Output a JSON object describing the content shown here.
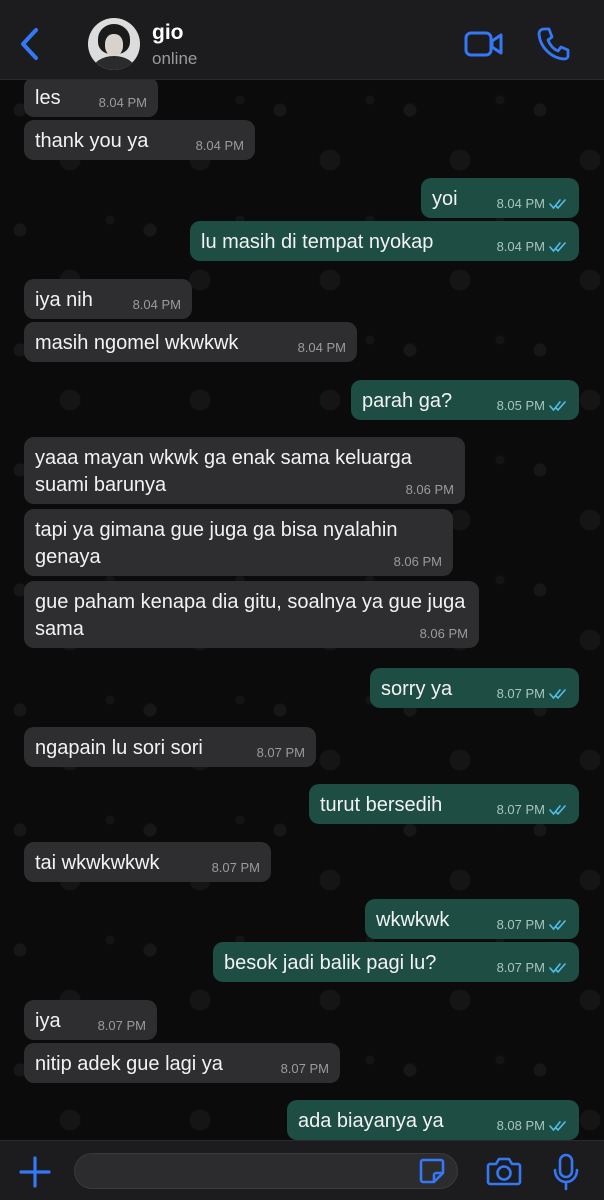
{
  "header": {
    "contact_name": "gio",
    "status": "online",
    "back_icon": "chevron-left-icon",
    "video_icon": "video-camera-icon",
    "call_icon": "phone-icon",
    "accent_color": "#3478f6"
  },
  "messages": [
    {
      "direction": "in",
      "text": "les",
      "time": "8.04 PM"
    },
    {
      "direction": "in",
      "text": "thank you ya",
      "time": "8.04 PM"
    },
    {
      "direction": "out",
      "text": "yoi",
      "time": "8.04 PM",
      "read": true
    },
    {
      "direction": "out",
      "text": "lu masih di tempat nyokap",
      "time": "8.04 PM",
      "read": true
    },
    {
      "direction": "in",
      "text": "iya nih",
      "time": "8.04 PM"
    },
    {
      "direction": "in",
      "text": "masih ngomel wkwkwk",
      "time": "8.04 PM"
    },
    {
      "direction": "out",
      "text": "parah ga?",
      "time": "8.05 PM",
      "read": true
    },
    {
      "direction": "in",
      "text": "yaaa mayan wkwk ga enak sama keluarga suami barunya",
      "time": "8.06 PM"
    },
    {
      "direction": "in",
      "text": "tapi ya gimana gue juga ga bisa nyalahin genaya",
      "time": "8.06 PM"
    },
    {
      "direction": "in",
      "text": "gue paham kenapa dia gitu, soalnya ya gue juga sama",
      "time": "8.06 PM"
    },
    {
      "direction": "out",
      "text": "sorry ya",
      "time": "8.07 PM",
      "read": true
    },
    {
      "direction": "in",
      "text": "ngapain lu sori sori",
      "time": "8.07 PM"
    },
    {
      "direction": "out",
      "text": "turut bersedih",
      "time": "8.07 PM",
      "read": true
    },
    {
      "direction": "in",
      "text": "tai wkwkwkwk",
      "time": "8.07 PM"
    },
    {
      "direction": "out",
      "text": "wkwkwk",
      "time": "8.07 PM",
      "read": true
    },
    {
      "direction": "out",
      "text": "besok jadi balik pagi lu?",
      "time": "8.07 PM",
      "read": true
    },
    {
      "direction": "in",
      "text": "iya",
      "time": "8.07 PM"
    },
    {
      "direction": "in",
      "text": "nitip adek gue lagi ya",
      "time": "8.07 PM"
    },
    {
      "direction": "out",
      "text": "ada biayanya ya",
      "time": "8.08 PM",
      "read": true
    }
  ],
  "input_bar": {
    "placeholder": "",
    "plus_icon": "plus-icon",
    "sticker_icon": "sticker-icon",
    "camera_icon": "camera-icon",
    "mic_icon": "microphone-icon"
  },
  "colors": {
    "incoming_bubble": "#2e2e30",
    "outgoing_bubble": "#1d4d43",
    "read_ticks": "#53bdeb",
    "background": "#0b0b0b"
  }
}
